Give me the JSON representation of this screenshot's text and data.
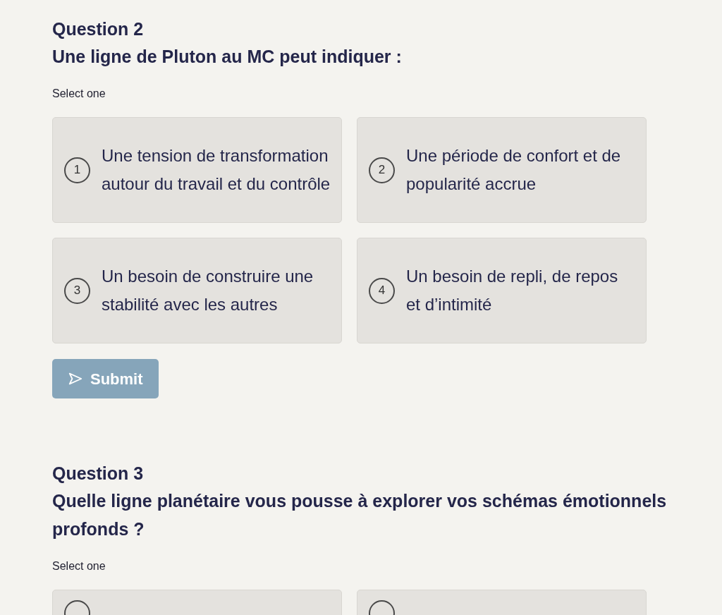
{
  "questions": [
    {
      "number": "Question 2",
      "prompt": "Une ligne de Pluton au MC peut indiquer :",
      "instruction": "Select one",
      "options": [
        {
          "kind": "full",
          "index": "1",
          "text": "Une tension de transformation autour du travail et du contrôle"
        },
        {
          "kind": "full",
          "index": "2",
          "text": "Une période de confort et de popularité accrue"
        },
        {
          "kind": "full",
          "index": "3",
          "text": "Un besoin de construire une stabilité avec les autres"
        },
        {
          "kind": "full",
          "index": "4",
          "text": "Un besoin de repli, de repos et d’intimité"
        }
      ],
      "submit": {
        "label": "Submit",
        "disabled": true
      }
    },
    {
      "number": "Question 3",
      "prompt": "Quelle ligne planétaire vous pousse à explorer vos schémas émotionnels profonds ?",
      "instruction": "Select one",
      "options": [
        {
          "kind": "cut"
        },
        {
          "kind": "cut"
        }
      ]
    }
  ]
}
